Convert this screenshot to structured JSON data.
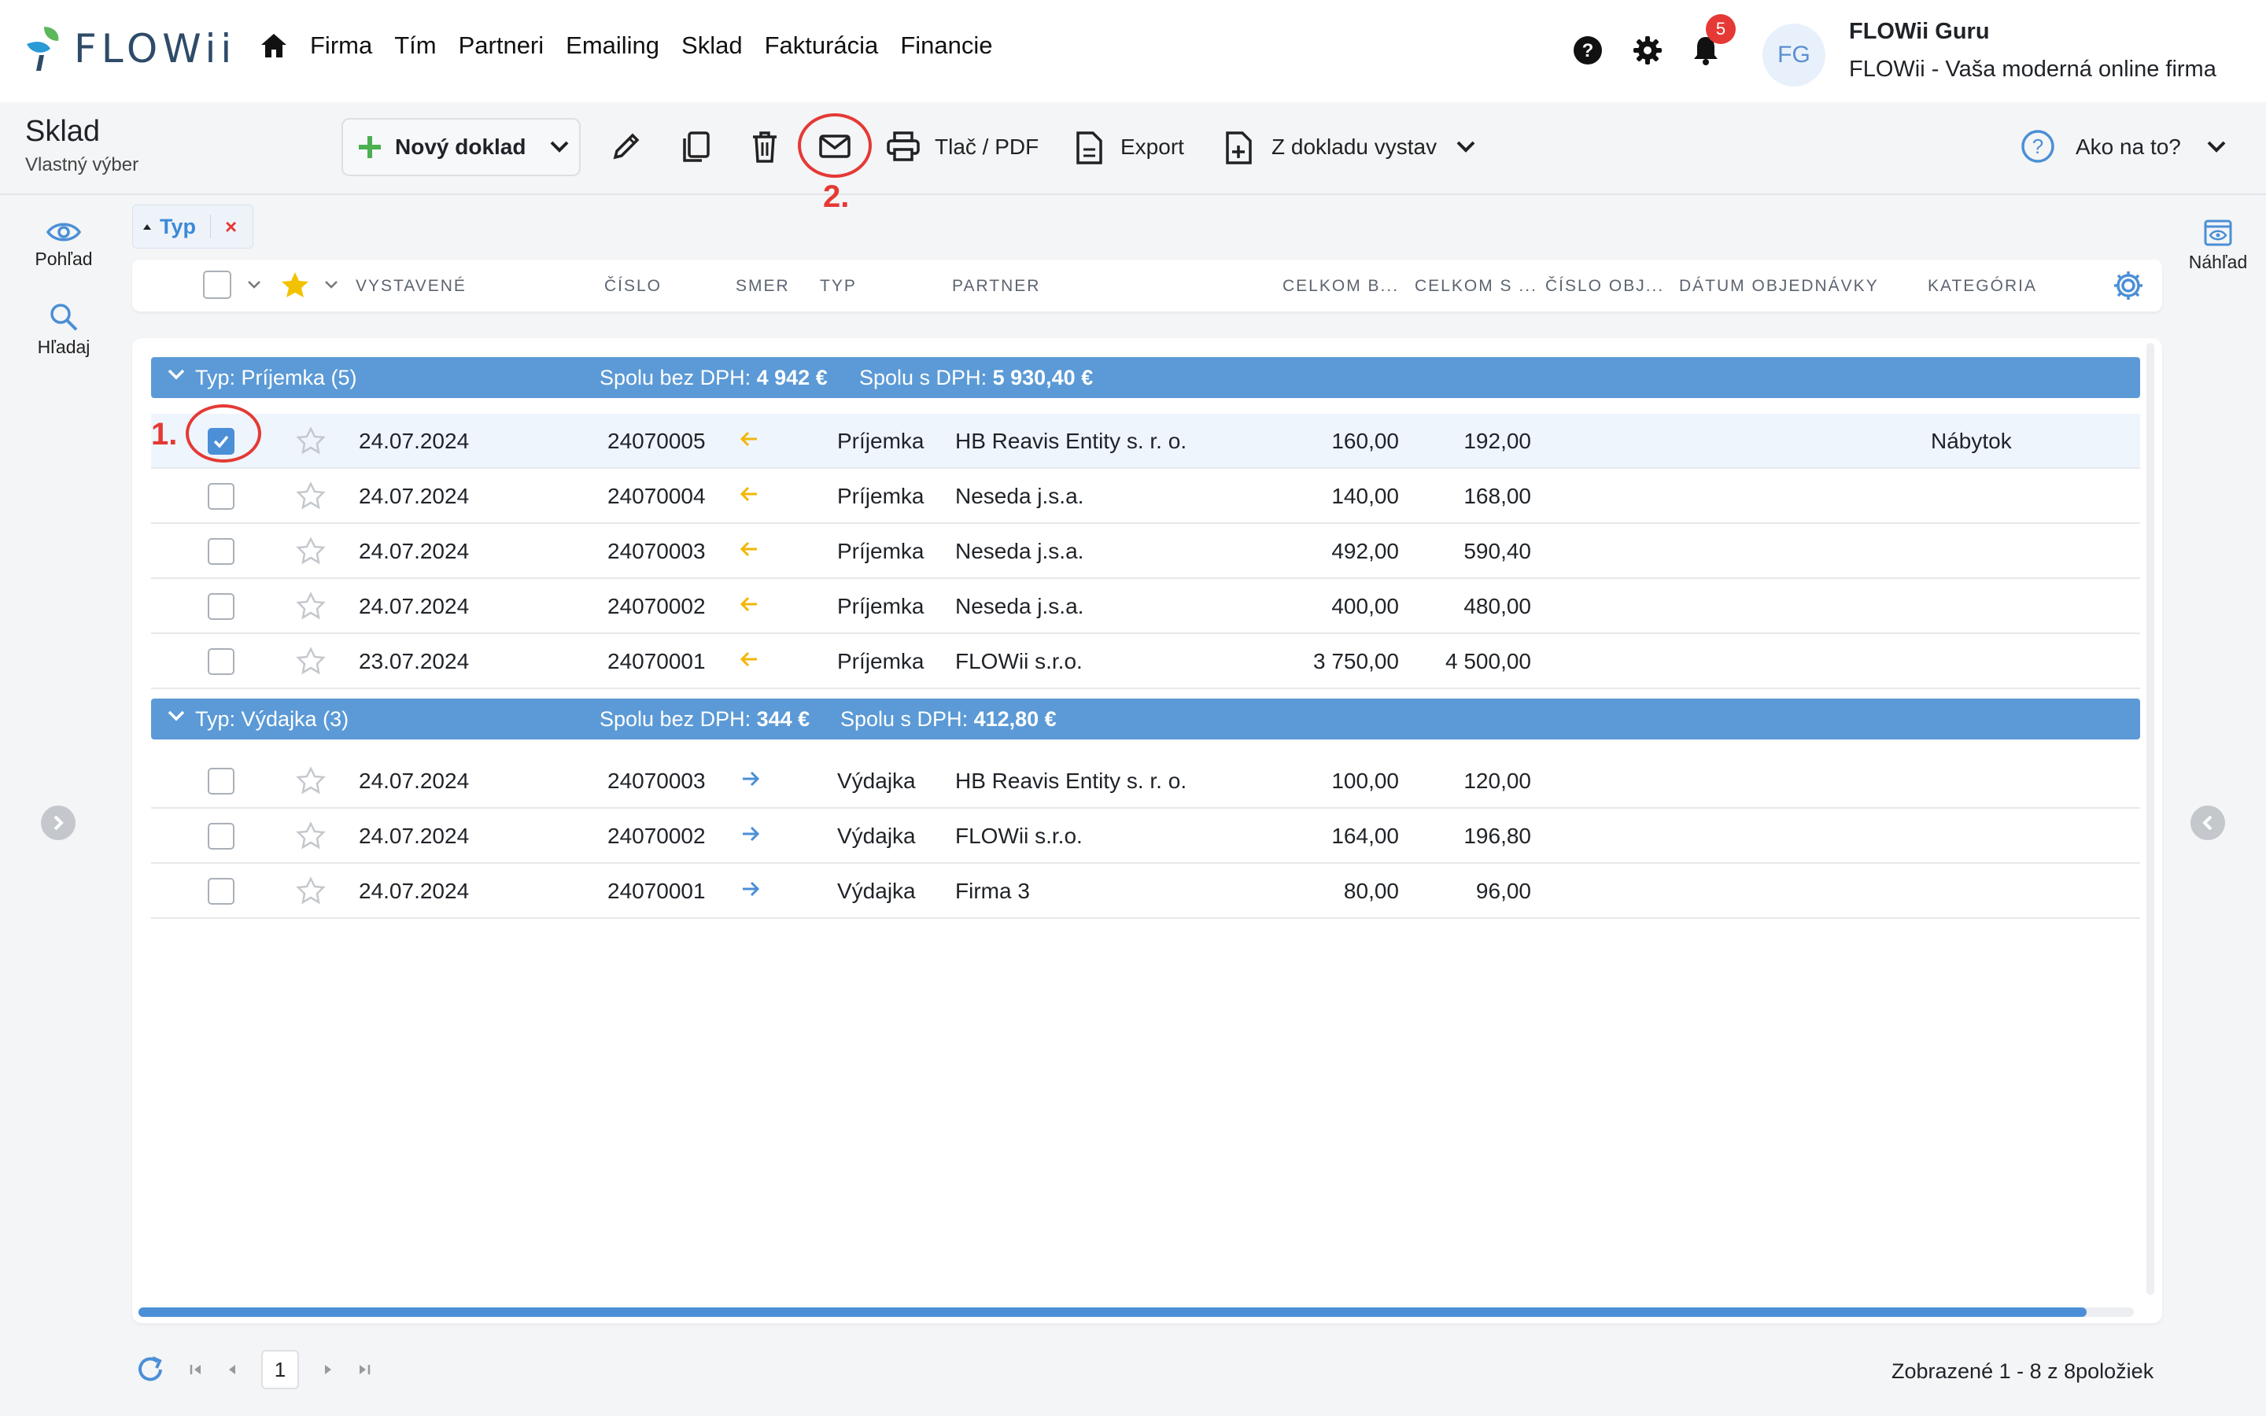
{
  "brand": {
    "name": "FLOWii"
  },
  "nav": {
    "items": [
      "Firma",
      "Tím",
      "Partneri",
      "Emailing",
      "Sklad",
      "Fakturácia",
      "Financie"
    ]
  },
  "user": {
    "initials": "FG",
    "name": "FLOWii Guru",
    "company": "FLOWii - Vaša moderná online firma"
  },
  "notifications": {
    "count": "5"
  },
  "page": {
    "title": "Sklad",
    "subtitle": "Vlastný výber"
  },
  "toolbar": {
    "new_doc": "Nový doklad",
    "print": "Tlač / PDF",
    "export": "Export",
    "from_doc": "Z dokladu vystav",
    "help": "Ako na to?"
  },
  "annotations": {
    "step1": "1.",
    "step2": "2."
  },
  "side": {
    "view": "Pohľad",
    "search": "Hľadaj",
    "preview": "Náhľad"
  },
  "filter": {
    "label": "Typ",
    "remove": "×"
  },
  "columns": [
    "VYSTAVENÉ",
    "ČÍSLO",
    "SMER",
    "TYP",
    "PARTNER",
    "CELKOM B...",
    "CELKOM S ...",
    "ČÍSLO OBJ...",
    "DÁTUM OBJEDNÁVKY",
    "KATEGÓRIA"
  ],
  "groups": [
    {
      "label": "Typ: Príjemka (5)",
      "sum_no_vat_label": "Spolu bez DPH:",
      "sum_no_vat": "4 942 €",
      "sum_vat_label": "Spolu s DPH:",
      "sum_vat": "5 930,40 €",
      "direction": "in",
      "rows": [
        {
          "date": "24.07.2024",
          "number": "24070005",
          "type": "Príjemka",
          "partner": "HB Reavis Entity s. r. o.",
          "total_no_vat": "160,00",
          "total_vat": "192,00",
          "category": "Nábytok",
          "checked": true
        },
        {
          "date": "24.07.2024",
          "number": "24070004",
          "type": "Príjemka",
          "partner": "Neseda j.s.a.",
          "total_no_vat": "140,00",
          "total_vat": "168,00",
          "category": ""
        },
        {
          "date": "24.07.2024",
          "number": "24070003",
          "type": "Príjemka",
          "partner": "Neseda j.s.a.",
          "total_no_vat": "492,00",
          "total_vat": "590,40",
          "category": ""
        },
        {
          "date": "24.07.2024",
          "number": "24070002",
          "type": "Príjemka",
          "partner": "Neseda j.s.a.",
          "total_no_vat": "400,00",
          "total_vat": "480,00",
          "category": ""
        },
        {
          "date": "23.07.2024",
          "number": "24070001",
          "type": "Príjemka",
          "partner": "FLOWii s.r.o.",
          "total_no_vat": "3 750,00",
          "total_vat": "4 500,00",
          "category": ""
        }
      ]
    },
    {
      "label": "Typ: Výdajka (3)",
      "sum_no_vat_label": "Spolu bez DPH:",
      "sum_no_vat": "344 €",
      "sum_vat_label": "Spolu s DPH:",
      "sum_vat": "412,80 €",
      "direction": "out",
      "rows": [
        {
          "date": "24.07.2024",
          "number": "24070003",
          "type": "Výdajka",
          "partner": "HB Reavis Entity s. r. o.",
          "total_no_vat": "100,00",
          "total_vat": "120,00",
          "category": ""
        },
        {
          "date": "24.07.2024",
          "number": "24070002",
          "type": "Výdajka",
          "partner": "FLOWii s.r.o.",
          "total_no_vat": "164,00",
          "total_vat": "196,80",
          "category": ""
        },
        {
          "date": "24.07.2024",
          "number": "24070001",
          "type": "Výdajka",
          "partner": "Firma 3",
          "total_no_vat": "80,00",
          "total_vat": "96,00",
          "category": ""
        }
      ]
    }
  ],
  "pagination": {
    "current": "1",
    "info": "Zobrazené 1 - 8 z 8položiek"
  },
  "colors": {
    "accent": "#4b8fd6",
    "group": "#5b9ad6",
    "annotation": "#e53935",
    "in_arrow": "#f2b705",
    "out_arrow": "#4b8fd6",
    "star": "#f2c200"
  }
}
